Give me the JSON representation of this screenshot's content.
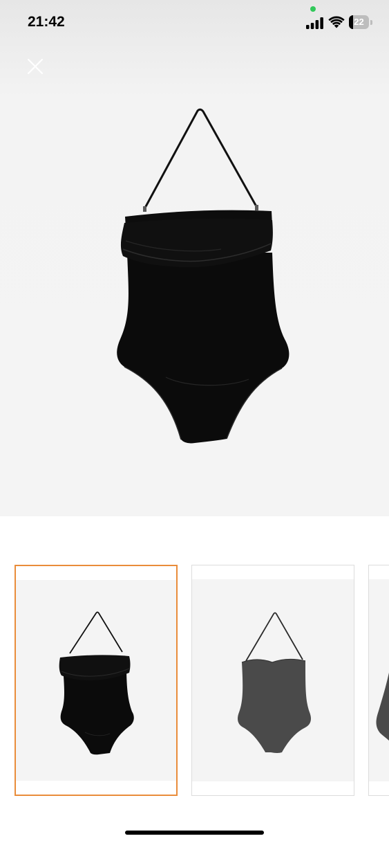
{
  "status_bar": {
    "time": "21:42",
    "battery_level": "22",
    "battery_fraction": 0.22,
    "recording_indicator_color": "#31c85a",
    "icons": [
      "signal-icon",
      "wifi-icon",
      "battery-icon"
    ]
  },
  "gallery": {
    "close_icon": "close-icon",
    "main_image": "black-ruffle-bandeau-swimsuit",
    "thumbnails": [
      {
        "image": "black-ruffle-bandeau-swimsuit",
        "selected": true
      },
      {
        "image": "grey-halter-swimsuit",
        "selected": false
      },
      {
        "image": "grey-swimsuit-partial",
        "selected": false
      }
    ],
    "selected_border_color": "#e98c3a"
  }
}
